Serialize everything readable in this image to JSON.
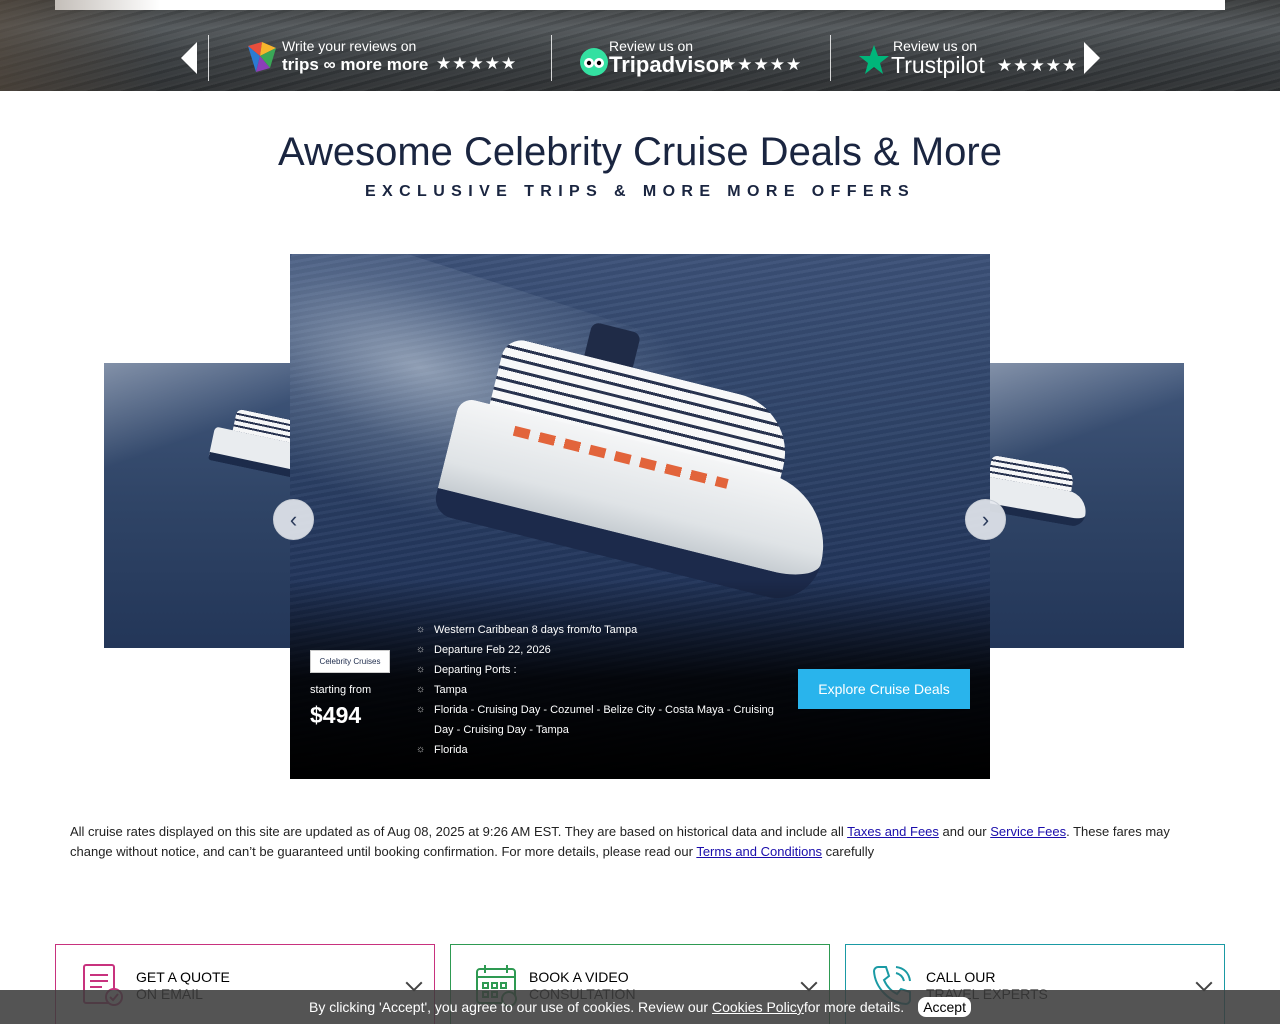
{
  "banner": {
    "reviews": [
      {
        "prefix": "Write your reviews on",
        "name": "trips ∞ more more",
        "stars": "★★★★★"
      },
      {
        "prefix": "Review us on",
        "name": "Tripadvisor",
        "stars": "★★★★★"
      },
      {
        "prefix": "Review us on",
        "name": "Trustpilot",
        "stars": "★★★★★"
      }
    ]
  },
  "heading": {
    "title": "Awesome Celebrity Cruise Deals & More",
    "subtitle": "EXCLUSIVE TRIPS & MORE MORE OFFERS"
  },
  "slide": {
    "brand": "Celebrity Cruises",
    "starting_label": "starting from",
    "price": "$494",
    "details": [
      "Western Caribbean 8 days from/to Tampa",
      "Departure Feb 22, 2026",
      "Departing Ports :",
      "Tampa",
      "Florida - Cruising Day - Cozumel - Belize City - Costa Maya - Cruising Day - Cruising Day - Tampa",
      "Florida"
    ],
    "cta": "Explore Cruise Deals"
  },
  "disclaimer": {
    "part1": "All cruise rates displayed on this site are updated as of Aug 08, 2025 at 9:26 AM EST. They are based on historical data and include all ",
    "link1": "Taxes and Fees",
    "part2": " and our ",
    "link2": "Service Fees",
    "part3": ". These fares may change without notice, and can’t be guaranteed until booking confirmation. For more details, please read our ",
    "link3": "Terms and Conditions",
    "part4": " carefully"
  },
  "contacts": [
    {
      "line1": "GET A QUOTE",
      "line2": "ON EMAIL",
      "color": "#c8327e"
    },
    {
      "line1": "BOOK A VIDEO",
      "line2": "CONSULTATION",
      "color": "#2e9a52"
    },
    {
      "line1": "CALL OUR",
      "line2": "TRAVEL EXPERTS",
      "color": "#1a9aa4"
    }
  ],
  "cookie": {
    "text1": "By clicking 'Accept', you agree to our use of cookies. Review our ",
    "link": "Cookies Policy",
    "text2": " for more details.",
    "accept": "Accept"
  }
}
